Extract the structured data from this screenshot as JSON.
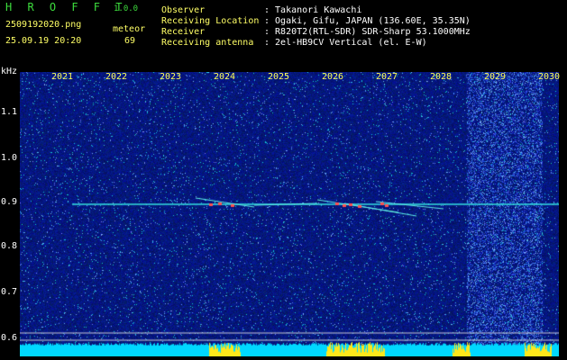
{
  "header": {
    "app_name": "H R O F F T",
    "version": "1.0.0",
    "filename": "2509192020.png",
    "datetime": "25.09.19 20:20",
    "meteor_label": "meteor",
    "meteor_count": "69",
    "info_labels": [
      "Observer",
      "Receiving Location",
      "Receiver",
      "Receiving antenna"
    ],
    "info_values": [
      ": Takanori Kawachi",
      ": Ogaki, Gifu, JAPAN (136.60E, 35.35N)",
      ": R820T2(RTL-SDR) SDR-Sharp 53.1000MHz",
      ": 2el-HB9CV Vertical (el. E-W)"
    ]
  },
  "axes": {
    "y_unit": "kHz",
    "y_ticks": [
      "1.1",
      "1.0",
      "0.9",
      "0.8",
      "0.7",
      "0.6"
    ],
    "x_ticks": [
      "2021",
      "2022",
      "2023",
      "2024",
      "2025",
      "2026",
      "2027",
      "2028",
      "2029",
      "2030"
    ]
  },
  "colors": {
    "background": "#000000",
    "noise": "#0a1a9a",
    "signal": "#33e0e0",
    "meteor_head": "#ff5050",
    "level_bar": "#00d8ff",
    "burst": "#ffe81a"
  }
}
